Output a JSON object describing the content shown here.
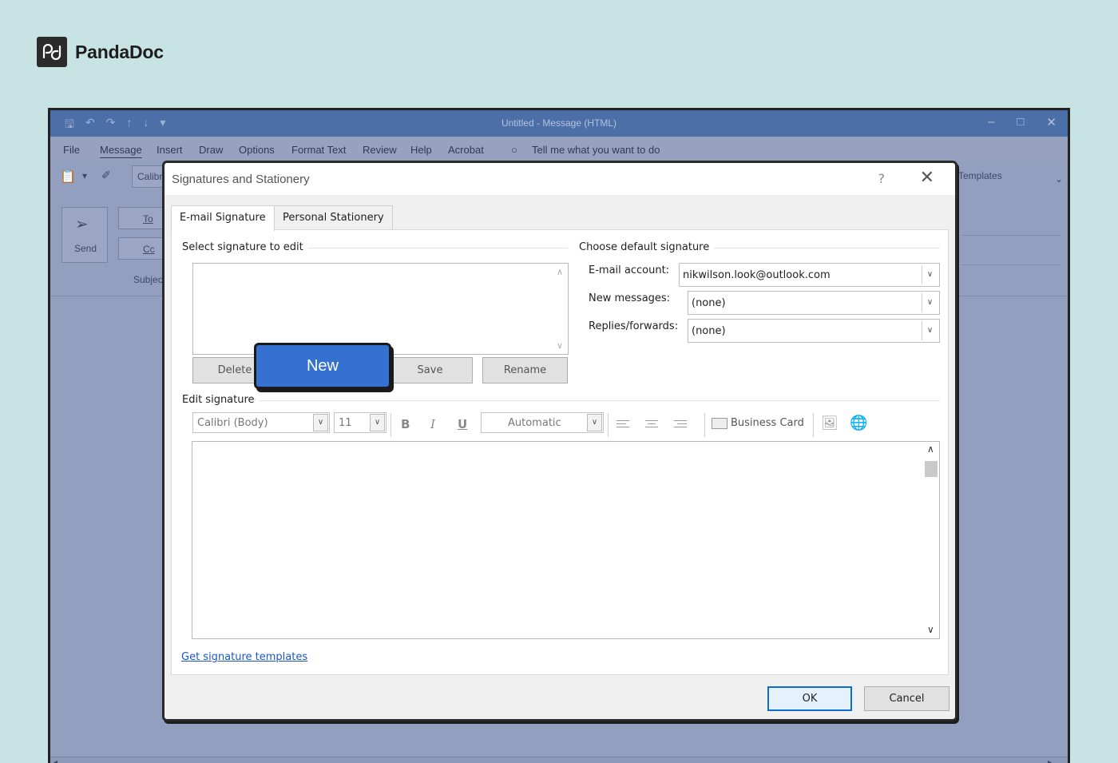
{
  "brand": {
    "name": "PandaDoc",
    "logo_icon": "pandadoc-logo-icon"
  },
  "outlook": {
    "window_title": "Untitled  -  Message (HTML)",
    "menu": [
      "File",
      "Message",
      "Insert",
      "Draw",
      "Options",
      "Format Text",
      "Review",
      "Help",
      "Acrobat"
    ],
    "menu_active": "Message",
    "tell_me": "Tell me what you want to do",
    "ribbon_font": "Calibri",
    "ribbon_templates": "Templates",
    "send_label": "Send",
    "to_label": "To",
    "cc_label": "Cc",
    "subject_label": "Subject"
  },
  "dialog": {
    "title": "Signatures and Stationery",
    "help": "?",
    "tabs": [
      {
        "label": "E-mail Signature",
        "active": true
      },
      {
        "label": "Personal Stationery",
        "active": false
      }
    ],
    "select_group_label": "Select signature to edit",
    "buttons": {
      "delete": "Delete",
      "new": "New",
      "save": "Save",
      "rename": "Rename"
    },
    "default_group_label": "Choose default signature",
    "email_account_label": "E-mail account:",
    "email_account_value": "nikwilson.look@outlook.com",
    "new_messages_label": "New messages:",
    "new_messages_value": "(none)",
    "replies_label": "Replies/forwards:",
    "replies_value": "(none)",
    "edit_group_label": "Edit signature",
    "font_value": "Calibri (Body)",
    "size_value": "11",
    "bold": "B",
    "italic": "I",
    "underline": "U",
    "color_value": "Automatic",
    "business_card": "Business Card",
    "templates_link": "Get signature templates",
    "ok": "OK",
    "cancel": "Cancel"
  }
}
